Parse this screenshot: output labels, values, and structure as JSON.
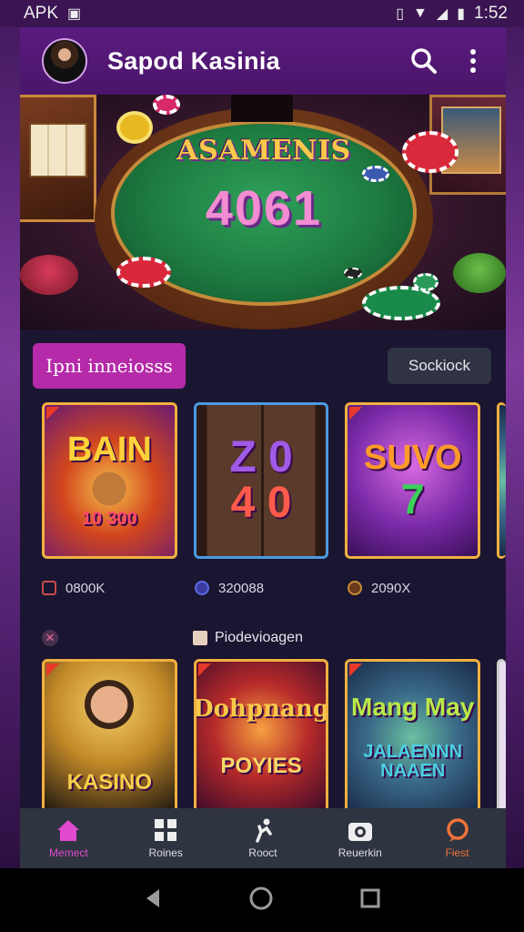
{
  "status_bar": {
    "left_text": "APK",
    "time": "1:52"
  },
  "app_bar": {
    "title": "Sapod Kasinia"
  },
  "hero": {
    "title": "ASAMENIS",
    "number": "4061"
  },
  "filters": {
    "primary": "Ipni inneiosss",
    "secondary": "Sockiock"
  },
  "games_row1": [
    {
      "art": "BAIN",
      "art_sub": "10 300"
    },
    {
      "art": "Z 0",
      "art_sub": "4 0"
    },
    {
      "art": "SUVO",
      "art_sub": "7"
    }
  ],
  "meta_row1": [
    "0800K",
    "320088",
    "2090X"
  ],
  "sub_row": {
    "label": "Piodevioagen"
  },
  "games_row2": [
    {
      "art": "KASINO"
    },
    {
      "art": "Dohpnang",
      "art_sub": "POYIES"
    },
    {
      "art": "Mang May",
      "art_sub": "JALAENNN NAAEN"
    }
  ],
  "bottom_nav": [
    {
      "label": "Memect",
      "icon": "home-icon"
    },
    {
      "label": "Roines",
      "icon": "grid-icon"
    },
    {
      "label": "Rooct",
      "icon": "figure-icon"
    },
    {
      "label": "Reuerkin",
      "icon": "camera-icon"
    },
    {
      "label": "Fiest",
      "icon": "chat-icon"
    }
  ],
  "colors": {
    "accent": "#b52aa8",
    "app_bar": "#4a1569",
    "nav_active": "#e24ad0",
    "nav_hot": "#f0743a"
  }
}
